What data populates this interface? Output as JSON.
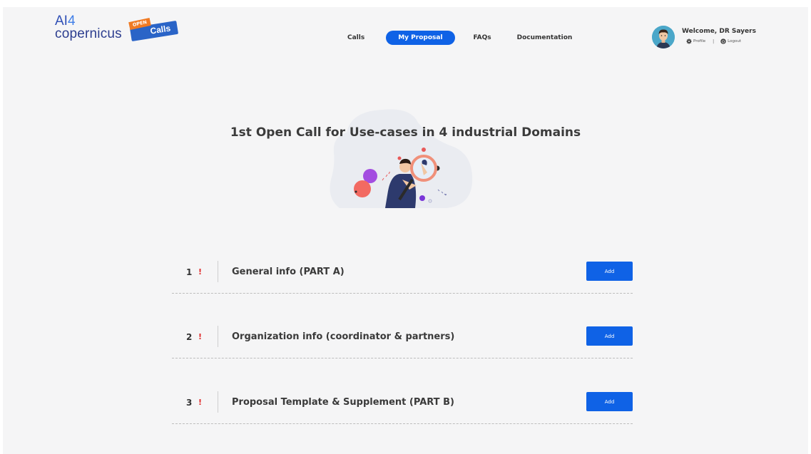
{
  "logo": {
    "ai_text": "AI",
    "four_text": "4",
    "copernicus_text": "copernicus",
    "tag_open": "OPEN",
    "tag_calls": "Calls"
  },
  "nav": {
    "items": [
      {
        "label": "Calls",
        "active": false
      },
      {
        "label": "My Proposal",
        "active": true
      },
      {
        "label": "FAQs",
        "active": false
      },
      {
        "label": "Documentation",
        "active": false
      }
    ]
  },
  "user": {
    "welcome": "Welcome, DR Sayers",
    "profile_label": "Profile",
    "separator": "|",
    "logout_label": "Logout"
  },
  "hero": {
    "title": "1st Open Call for Use-cases in 4 industrial Domains"
  },
  "steps": [
    {
      "number": "1",
      "warning": "!",
      "title": "General info (PART A)",
      "button": "Add"
    },
    {
      "number": "2",
      "warning": "!",
      "title": "Organization info (coordinator & partners)",
      "button": "Add"
    },
    {
      "number": "3",
      "warning": "!",
      "title": "Proposal Template & Supplement (PART B)",
      "button": "Add"
    }
  ],
  "colors": {
    "accent": "#0f62e6",
    "warning": "#e02b2b",
    "background": "#f5f5f6",
    "tag_orange": "#f07a23"
  },
  "icons": {
    "profile": "gear-icon",
    "logout": "power-icon",
    "illustration": "magnifier-person-illustration"
  }
}
